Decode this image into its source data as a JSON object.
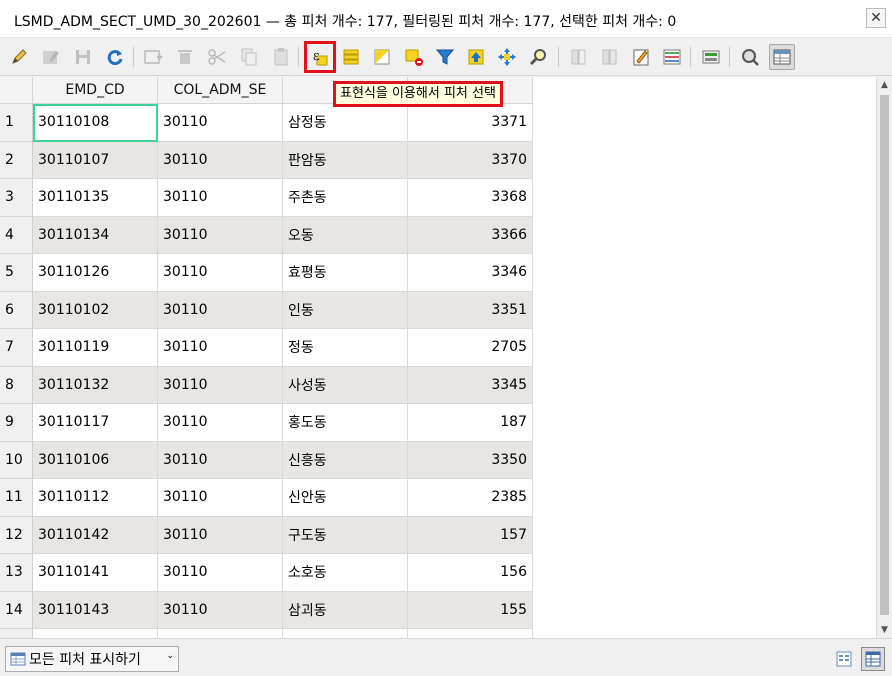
{
  "window": {
    "title": "LSMD_ADM_SECT_UMD_30_202601 — 총 피처 개수: 177, 필터링된 피처 개수: 177, 선택한 피처 개수: 0",
    "close_label": "✕"
  },
  "toolbar": {
    "buttons": [
      {
        "name": "toggle-editing",
        "icon": "pencil-icon",
        "enabled": true
      },
      {
        "name": "multi-edit",
        "icon": "multi-edit-icon",
        "enabled": false
      },
      {
        "name": "save-edits",
        "icon": "save-icon",
        "enabled": false
      },
      {
        "name": "reload",
        "icon": "reload-icon",
        "enabled": true
      },
      {
        "name": "add-feature",
        "icon": "add-feature-icon",
        "enabled": false
      },
      {
        "name": "delete-selected",
        "icon": "trash-icon",
        "enabled": false
      },
      {
        "name": "cut-selected",
        "icon": "scissors-icon",
        "enabled": false
      },
      {
        "name": "copy-selected",
        "icon": "copy-icon",
        "enabled": false
      },
      {
        "name": "paste-features",
        "icon": "paste-icon",
        "enabled": false
      },
      {
        "name": "select-by-expression",
        "icon": "expression-select-icon",
        "enabled": true,
        "highlighted": true
      },
      {
        "name": "select-all",
        "icon": "select-all-icon",
        "enabled": true
      },
      {
        "name": "invert-selection",
        "icon": "invert-selection-icon",
        "enabled": true
      },
      {
        "name": "deselect-all",
        "icon": "deselect-icon",
        "enabled": true
      },
      {
        "name": "filter-select",
        "icon": "filter-icon",
        "enabled": true
      },
      {
        "name": "move-selection-top",
        "icon": "move-top-icon",
        "enabled": true
      },
      {
        "name": "pan-to-selected",
        "icon": "pan-icon",
        "enabled": true
      },
      {
        "name": "zoom-to-selected",
        "icon": "zoom-icon",
        "enabled": true
      },
      {
        "name": "new-field",
        "icon": "new-field-icon",
        "enabled": false
      },
      {
        "name": "delete-field",
        "icon": "delete-field-icon",
        "enabled": false
      },
      {
        "name": "field-calculator",
        "icon": "field-calculator-icon",
        "enabled": true
      },
      {
        "name": "conditional-formatting",
        "icon": "conditional-format-icon",
        "enabled": true
      },
      {
        "name": "actions",
        "icon": "actions-icon",
        "enabled": true
      },
      {
        "name": "dock-undock",
        "icon": "dock-icon",
        "enabled": true
      },
      {
        "name": "table-view-toggle",
        "icon": "table-view-icon",
        "enabled": true,
        "pressed": true
      }
    ]
  },
  "tooltip": {
    "text": "표현식을 이용해서 피처 선택"
  },
  "table": {
    "columns": [
      "EMD_CD",
      "COL_ADM_SE",
      "EM",
      ""
    ],
    "rows": [
      {
        "n": "1",
        "emd_cd": "30110108",
        "col": "30110",
        "emd_nm": "삼정동",
        "val": "3371"
      },
      {
        "n": "2",
        "emd_cd": "30110107",
        "col": "30110",
        "emd_nm": "판암동",
        "val": "3370"
      },
      {
        "n": "3",
        "emd_cd": "30110135",
        "col": "30110",
        "emd_nm": "주촌동",
        "val": "3368"
      },
      {
        "n": "4",
        "emd_cd": "30110134",
        "col": "30110",
        "emd_nm": "오동",
        "val": "3366"
      },
      {
        "n": "5",
        "emd_cd": "30110126",
        "col": "30110",
        "emd_nm": "효평동",
        "val": "3346"
      },
      {
        "n": "6",
        "emd_cd": "30110102",
        "col": "30110",
        "emd_nm": "인동",
        "val": "3351"
      },
      {
        "n": "7",
        "emd_cd": "30110119",
        "col": "30110",
        "emd_nm": "정동",
        "val": "2705"
      },
      {
        "n": "8",
        "emd_cd": "30110132",
        "col": "30110",
        "emd_nm": "사성동",
        "val": "3345"
      },
      {
        "n": "9",
        "emd_cd": "30110117",
        "col": "30110",
        "emd_nm": "홍도동",
        "val": "187"
      },
      {
        "n": "10",
        "emd_cd": "30110106",
        "col": "30110",
        "emd_nm": "신흥동",
        "val": "3350"
      },
      {
        "n": "11",
        "emd_cd": "30110112",
        "col": "30110",
        "emd_nm": "신안동",
        "val": "2385"
      },
      {
        "n": "12",
        "emd_cd": "30110142",
        "col": "30110",
        "emd_nm": "구도동",
        "val": "157"
      },
      {
        "n": "13",
        "emd_cd": "30110141",
        "col": "30110",
        "emd_nm": "소호동",
        "val": "156"
      },
      {
        "n": "14",
        "emd_cd": "30110143",
        "col": "30110",
        "emd_nm": "삼괴동",
        "val": "155"
      }
    ]
  },
  "bottombar": {
    "show_all_label": "모든 피처 표시하기"
  },
  "colors": {
    "highlight": "#e3101b",
    "current_cell": "#3ad39a",
    "alt_row": "#e8e6e3"
  }
}
